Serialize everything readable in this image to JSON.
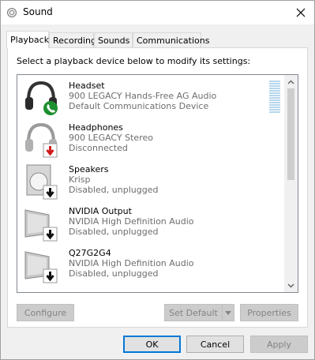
{
  "window": {
    "title": "Sound"
  },
  "tabs": [
    {
      "label": "Playback",
      "active": true
    },
    {
      "label": "Recording",
      "active": false
    },
    {
      "label": "Sounds",
      "active": false
    },
    {
      "label": "Communications",
      "active": false
    }
  ],
  "instruction": "Select a playback device below to modify its settings:",
  "devices": [
    {
      "name": "Headset",
      "driver": "900 LEGACY Hands-Free AG Audio",
      "status": "Default Communications Device",
      "icon": "headset-icon",
      "badge": "phone-badge-icon"
    },
    {
      "name": "Headphones",
      "driver": "900 LEGACY Stereo",
      "status": "Disconnected",
      "icon": "headphones-icon",
      "badge": "red-down-arrow-icon"
    },
    {
      "name": "Speakers",
      "driver": "Krisp",
      "status": "Disabled, unplugged",
      "icon": "speaker-icon",
      "badge": "down-arrow-icon"
    },
    {
      "name": "NVIDIA Output",
      "driver": "NVIDIA High Definition Audio",
      "status": "Disabled, unplugged",
      "icon": "monitor-icon",
      "badge": "down-arrow-icon"
    },
    {
      "name": "Q27G2G4",
      "driver": "NVIDIA High Definition Audio",
      "status": "Disabled, unplugged",
      "icon": "monitor-icon",
      "badge": "down-arrow-icon"
    }
  ],
  "buttons": {
    "configure": "Configure",
    "set_default": "Set Default",
    "properties": "Properties",
    "ok": "OK",
    "cancel": "Cancel",
    "apply": "Apply"
  },
  "colors": {
    "accent": "#0078d7",
    "phone_badge": "#1e8f2e",
    "disconnected_arrow": "#d11a1a"
  }
}
